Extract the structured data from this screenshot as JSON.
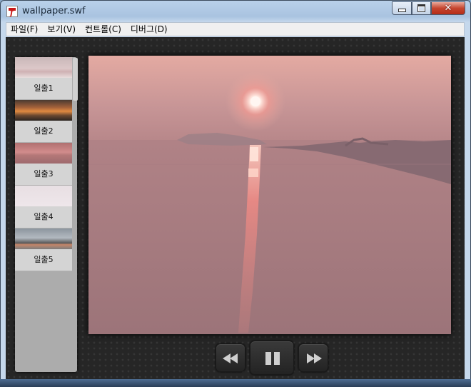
{
  "window": {
    "title": "wallpaper.swf",
    "controls": {
      "minimize_icon": "minimize-icon",
      "maximize_icon": "maximize-icon",
      "close_icon": "close-icon"
    }
  },
  "menubar": {
    "items": [
      {
        "label": "파일(F)"
      },
      {
        "label": "보기(V)"
      },
      {
        "label": "컨트롤(C)"
      },
      {
        "label": "디버그(D)"
      }
    ]
  },
  "sidebar": {
    "thumbnails": [
      {
        "label": "일출1"
      },
      {
        "label": "일출2"
      },
      {
        "label": "일출3"
      },
      {
        "label": "일출4"
      },
      {
        "label": "일출5"
      }
    ]
  },
  "player": {
    "rewind_icon": "rewind-icon",
    "pause_icon": "pause-icon",
    "fast_forward_icon": "fast-forward-icon"
  },
  "colors": {
    "client_background": "#262626",
    "sidebar_background": "#acacac",
    "sun": "#ffe8e0",
    "sky_top": "#e4aaa2",
    "water": "#a57c80"
  }
}
